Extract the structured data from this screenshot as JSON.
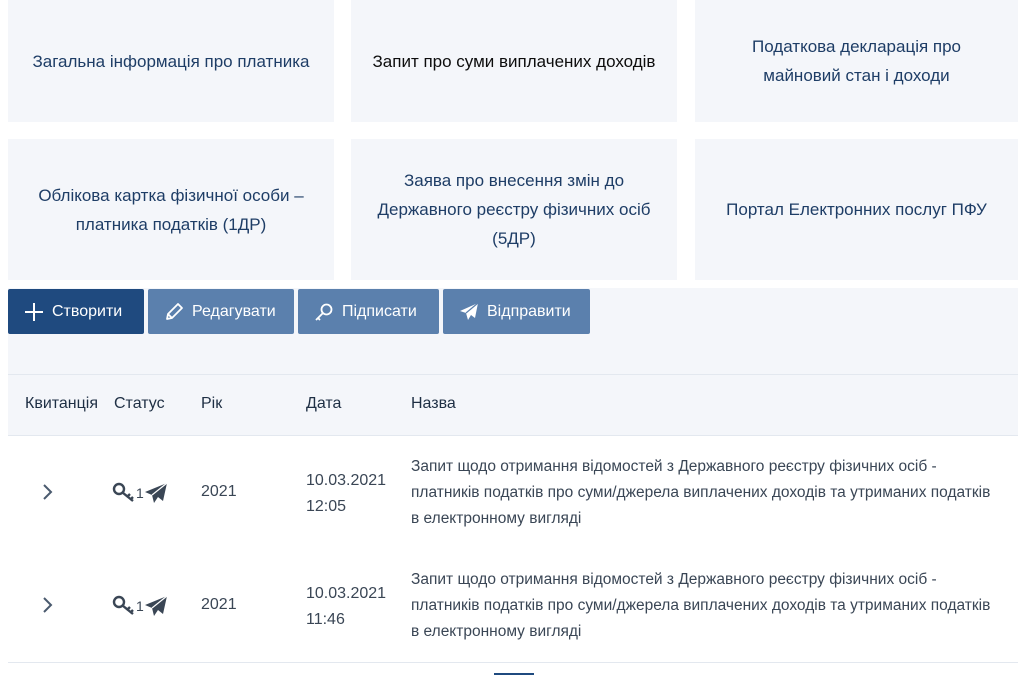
{
  "tiles": [
    {
      "label": "Загальна інформація про платника"
    },
    {
      "label": "Запит про суми виплачених доходів"
    },
    {
      "label": "Податкова декларація про майновий стан і доходи"
    },
    {
      "label": "Облікова картка фізичної особи – платника податків (1ДР)"
    },
    {
      "label": "Заява про внесення змін до Державного реєстру фізичних осіб (5ДР)"
    },
    {
      "label": "Портал Електронних послуг ПФУ"
    }
  ],
  "toolbar": {
    "create_label": "Створити",
    "edit_label": "Редагувати",
    "sign_label": "Підписати",
    "send_label": "Відправити"
  },
  "table": {
    "columns": [
      "Квитанція",
      "Статус",
      "Рік",
      "Дата",
      "Назва"
    ],
    "rows": [
      {
        "status_count": "1",
        "year": "2021",
        "date": "10.03.2021",
        "time": "12:05",
        "name": "Запит щодо отримання відомостей з Державного реєстру фізичних осіб - платників податків про суми/джерела виплачених доходів та утриманих податків в електронному вигляді"
      },
      {
        "status_count": "1",
        "year": "2021",
        "date": "10.03.2021",
        "time": "11:46",
        "name": "Запит щодо отримання відомостей з Державного реєстру фізичних осіб - платників податків про суми/джерела виплачених доходів та утриманих податків в електронному вигляді"
      }
    ]
  },
  "colors": {
    "primary": "#1f4a7f",
    "secondary": "#5b80ad",
    "tile_bg": "#f4f6fa",
    "tile_text": "#1e3d66"
  },
  "icons": [
    "plus-icon",
    "pencil-icon",
    "key-icon",
    "paper-plane-icon",
    "chevron-right-icon"
  ]
}
